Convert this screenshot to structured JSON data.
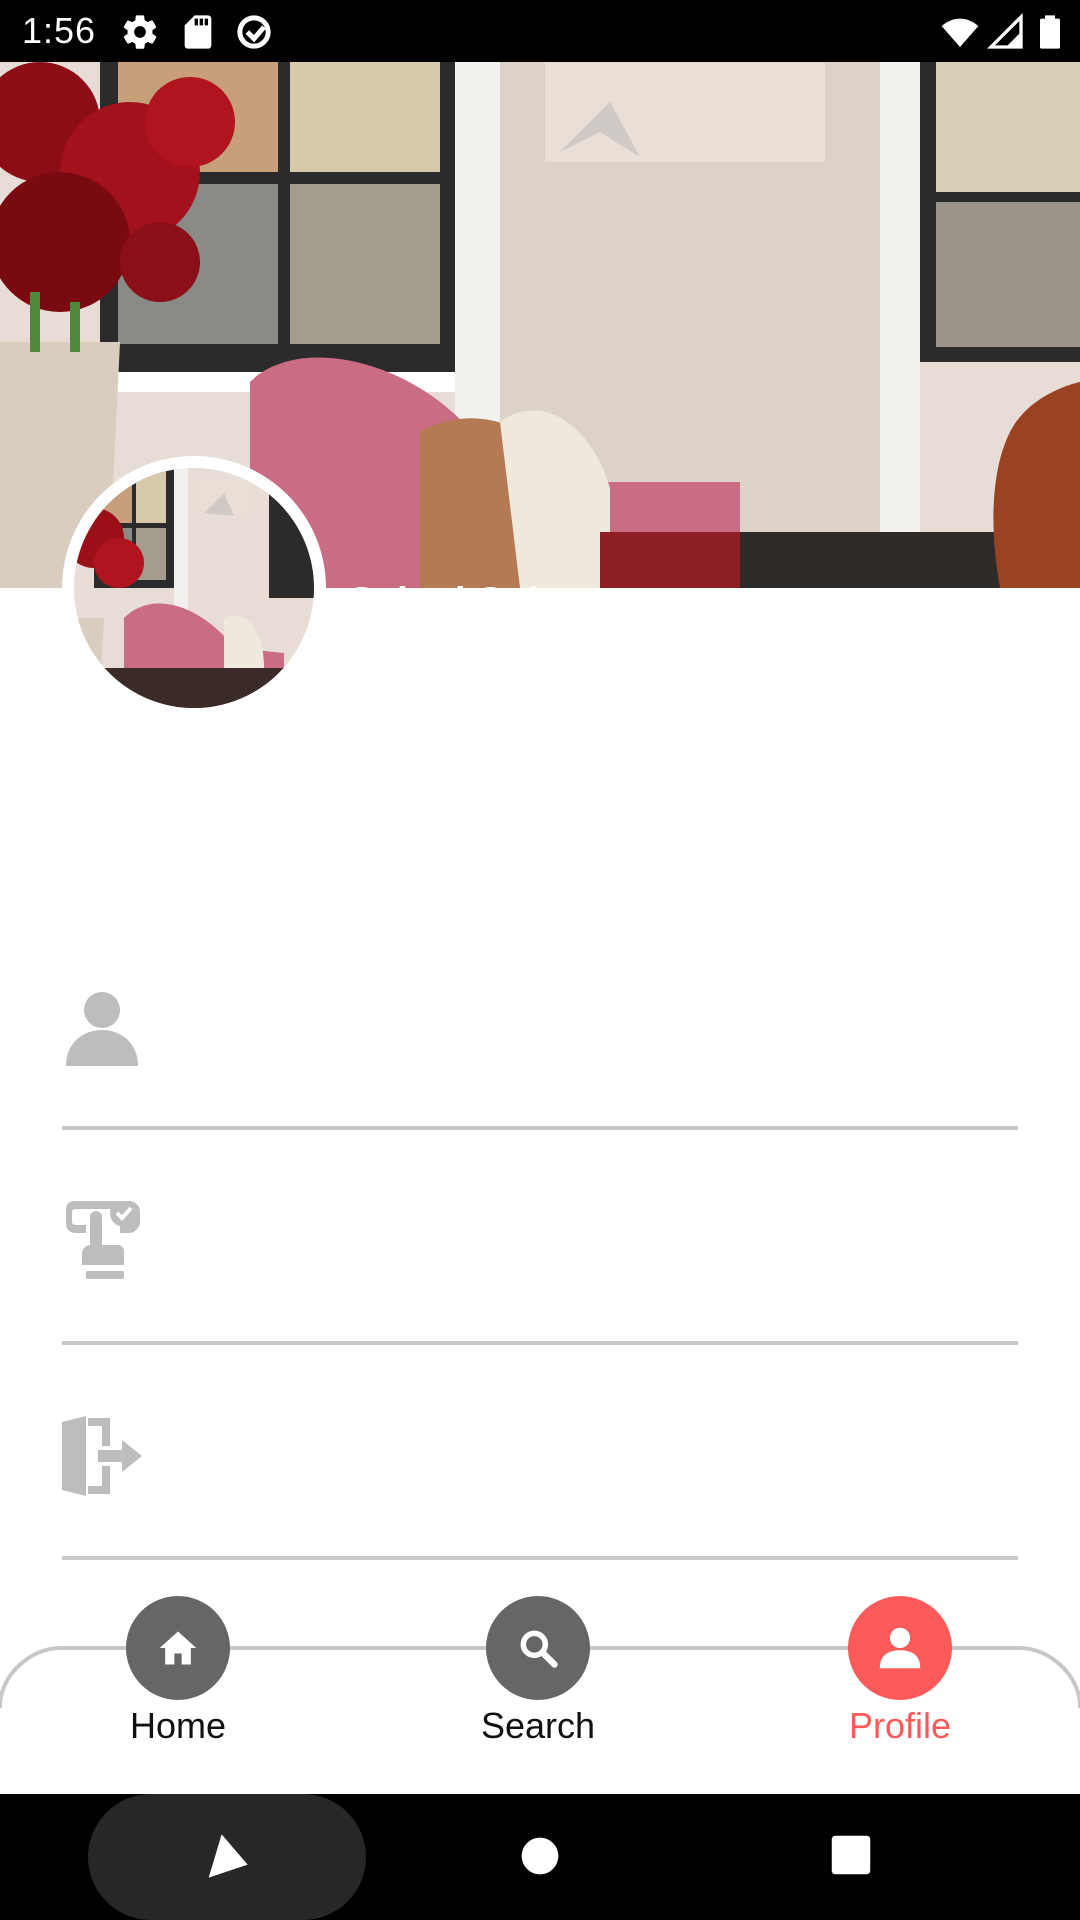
{
  "status_bar": {
    "time": "1:56",
    "left_icons": [
      "settings-icon",
      "sd-card-icon",
      "sync-icon"
    ],
    "right_icons": [
      "wifi-icon",
      "signal-icon",
      "battery-icon"
    ]
  },
  "profile": {
    "name": "Sainal Sultan"
  },
  "menu": {
    "items": [
      {
        "icon": "person-icon",
        "label": ""
      },
      {
        "icon": "touch-check-icon",
        "label": ""
      },
      {
        "icon": "logout-icon",
        "label": ""
      }
    ]
  },
  "bottom_nav": {
    "items": [
      {
        "label": "Home",
        "icon": "home-icon",
        "active": false
      },
      {
        "label": "Search",
        "icon": "search-icon",
        "active": false
      },
      {
        "label": "Profile",
        "icon": "profile-icon",
        "active": true
      }
    ],
    "active_color": "#fa5a5a",
    "inactive_color": "#666666"
  },
  "system_nav": {
    "buttons": [
      "back-button",
      "home-button",
      "recents-button"
    ]
  }
}
